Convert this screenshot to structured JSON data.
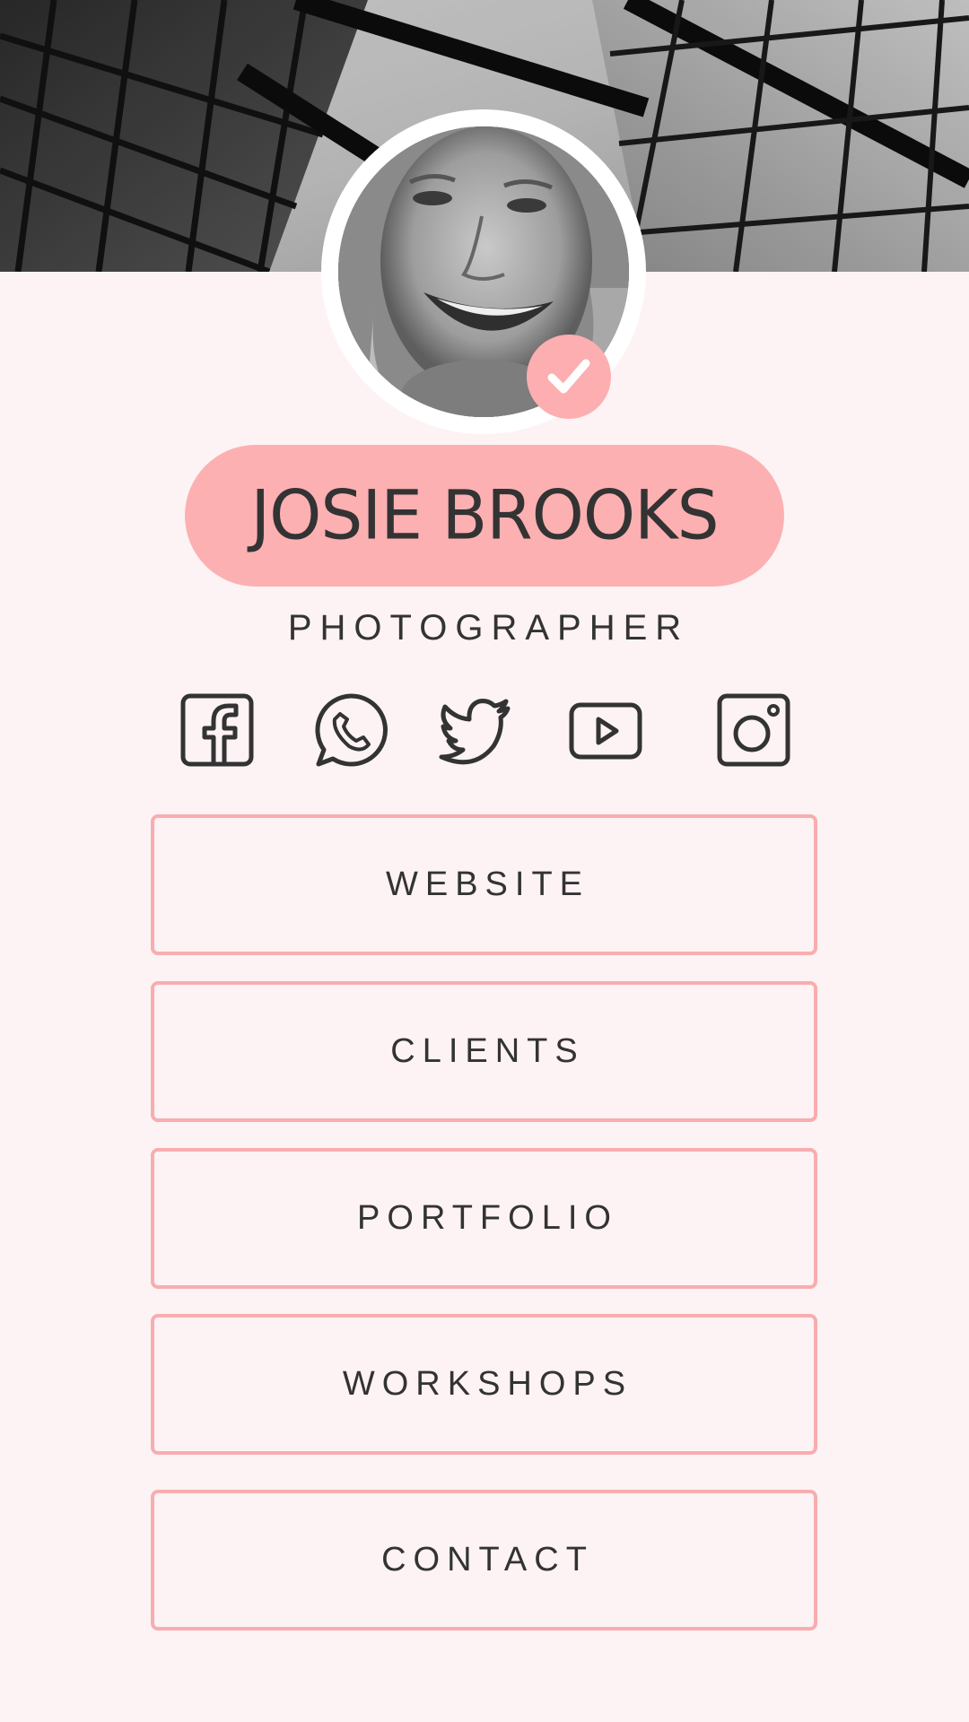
{
  "profile": {
    "name": "JOSIE BROOKS",
    "title": "PHOTOGRAPHER",
    "verified": true,
    "avatar_description_icon": "portrait-photo",
    "header_image_icon": "architecture-photo"
  },
  "social": [
    {
      "network": "facebook",
      "icon": "facebook-icon"
    },
    {
      "network": "whatsapp",
      "icon": "whatsapp-icon"
    },
    {
      "network": "twitter",
      "icon": "twitter-icon"
    },
    {
      "network": "youtube",
      "icon": "youtube-icon"
    },
    {
      "network": "instagram",
      "icon": "instagram-icon"
    }
  ],
  "links": [
    {
      "label": "WEBSITE"
    },
    {
      "label": "CLIENTS"
    },
    {
      "label": "PORTFOLIO"
    },
    {
      "label": "WORKSHOPS"
    },
    {
      "label": "CONTACT"
    }
  ],
  "colors": {
    "background": "#fdf3f4",
    "accent": "#fcb0b2",
    "border": "#f8adb0",
    "text": "#333333"
  }
}
